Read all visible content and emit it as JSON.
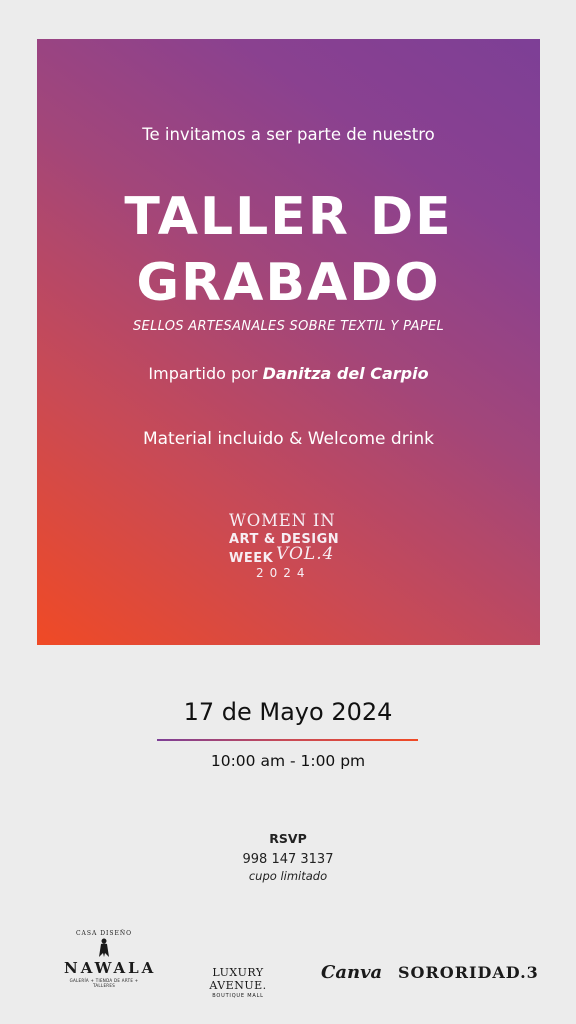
{
  "poster": {
    "intro": "Te invitamos a ser parte de nuestro",
    "title_line1": "TALLER DE",
    "title_line2": "GRABADO",
    "subtitle": "SELLOS ARTESANALES SOBRE TEXTIL Y PAPEL",
    "instructor_prefix": "Impartido por ",
    "instructor_name": "Danitza del Carpio",
    "material": "Material incluido & Welcome drink",
    "event_logo": {
      "line1": "WOMEN IN",
      "line2": "ART & DESIGN",
      "line3": "WEEK",
      "vol": "VOL.4",
      "year": "2024"
    },
    "gradient_colors": [
      "#f04a25",
      "#c94a55",
      "#a2467a",
      "#7d3f96"
    ]
  },
  "event": {
    "date": "17 de Mayo 2024",
    "time": "10:00 am - 1:00 pm"
  },
  "rsvp": {
    "label": "RSVP",
    "phone": "998 147 3137",
    "note": "cupo limitado"
  },
  "sponsors": {
    "nawala": {
      "top": "CASA DISEÑO",
      "name": "NAWALA",
      "sub": "GALERÍA + TIENDA DE ARTE + TALLERES"
    },
    "luxury": {
      "name": "LUXURY AVENUE.",
      "sub": "BOUTIQUE MALL"
    },
    "canva": "Canva",
    "sororidad": "SORORIDAD.3"
  }
}
